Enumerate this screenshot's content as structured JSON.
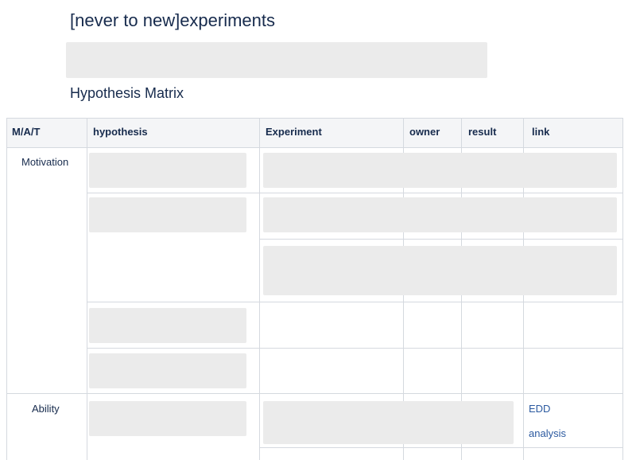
{
  "page": {
    "title": "[never to new]experiments",
    "section_heading": "Hypothesis Matrix"
  },
  "table": {
    "headers": [
      "M/A/T",
      "hypothesis",
      "Experiment",
      "owner",
      "result",
      "link"
    ],
    "rows": [
      {
        "category": "Motivation"
      },
      {
        "category": "Ability",
        "link_lines": [
          "EDD",
          "analysis"
        ]
      }
    ]
  },
  "colors": {
    "redacted_block": "#ebebeb",
    "header_background": "#f4f5f7",
    "grid_line": "#d5d9df",
    "link": "#2c5aa0",
    "text": "#172b4d"
  }
}
